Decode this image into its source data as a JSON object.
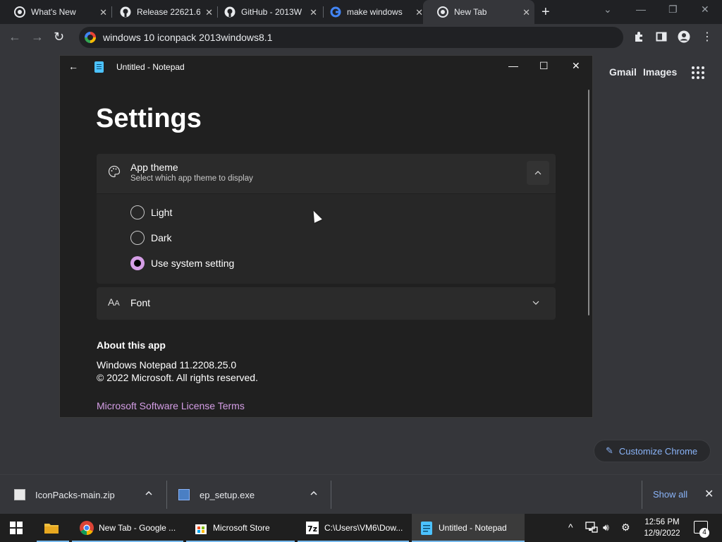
{
  "browser": {
    "tabs": [
      {
        "label": "What's New",
        "icon": "chrome-icon"
      },
      {
        "label": "Release 22621.6",
        "icon": "github-icon"
      },
      {
        "label": "GitHub - 2013W",
        "icon": "github-icon"
      },
      {
        "label": "make windows",
        "icon": "google-icon"
      },
      {
        "label": "New Tab",
        "icon": "chrome-icon",
        "active": true
      }
    ],
    "address": "windows 10 iconpack 2013windows8.1",
    "ntp": {
      "gmail": "Gmail",
      "images": "Images",
      "customize": "Customize Chrome"
    }
  },
  "notepad": {
    "window_title": "Untitled - Notepad",
    "settings_title": "Settings",
    "app_theme": {
      "title": "App theme",
      "subtitle": "Select which app theme to display",
      "options": [
        {
          "label": "Light",
          "checked": false
        },
        {
          "label": "Dark",
          "checked": false
        },
        {
          "label": "Use system setting",
          "checked": true
        }
      ]
    },
    "font": {
      "title": "Font"
    },
    "about": {
      "heading": "About this app",
      "version": "Windows Notepad 11.2208.25.0",
      "copyright": "© 2022 Microsoft. All rights reserved.",
      "license_link": "Microsoft Software License Terms"
    },
    "accent_color": "#d59ee6"
  },
  "downloads": {
    "items": [
      {
        "name": "IconPacks-main.zip"
      },
      {
        "name": "ep_setup.exe"
      }
    ],
    "show_all": "Show all"
  },
  "taskbar": {
    "apps": [
      {
        "label": "",
        "icon": "file-explorer-icon"
      },
      {
        "label": "New Tab - Google ...",
        "icon": "chrome-icon"
      },
      {
        "label": "Microsoft Store",
        "icon": "store-icon"
      },
      {
        "label": "C:\\Users\\VM6\\Dow...",
        "icon": "7zip-icon"
      },
      {
        "label": "Untitled - Notepad",
        "icon": "notepad-icon",
        "active": true
      }
    ],
    "time": "12:56 PM",
    "date": "12/9/2022",
    "notification_count": "4"
  }
}
